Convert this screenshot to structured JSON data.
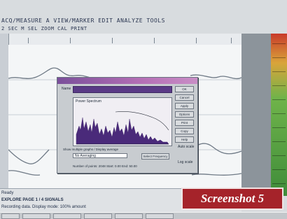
{
  "toolbar": {
    "row1_text": "ACQ/MEASURE  A VIEW/MARKER  EDIT  ANALYZE  TOOLS",
    "row2_text": "2 SEC  M  SEL  ZOOM  CAL  PRINT"
  },
  "dialog": {
    "field_label": "Name",
    "spectrum_title": "Power Spectrum",
    "buttons": [
      "OK",
      "Cancel",
      "Apply",
      "Options",
      "Print",
      "Copy",
      "Help"
    ],
    "checkbox_label": "Auto scale",
    "checkbox2_label": "Log scale",
    "option_row": "Show multiple graphs / Display average",
    "select_value": "No Averaging",
    "range_button": "Select Frequency",
    "footer_text": "Number of points: 2048   Start: 0.00   End: 50.00"
  },
  "bottombar": {
    "line1": "Ready",
    "line2": "EXPLORE  PAGE 1 / 4  SIGNALS",
    "line3": "Recording data. Display mode: 100% amount"
  },
  "badge": {
    "label": "Screenshot 5"
  },
  "colors": {
    "badge_bg": "#a5232a",
    "dialog_title": "#b46fb5",
    "spectrum": "#4a2a7a",
    "trace": "#6f7a86"
  }
}
